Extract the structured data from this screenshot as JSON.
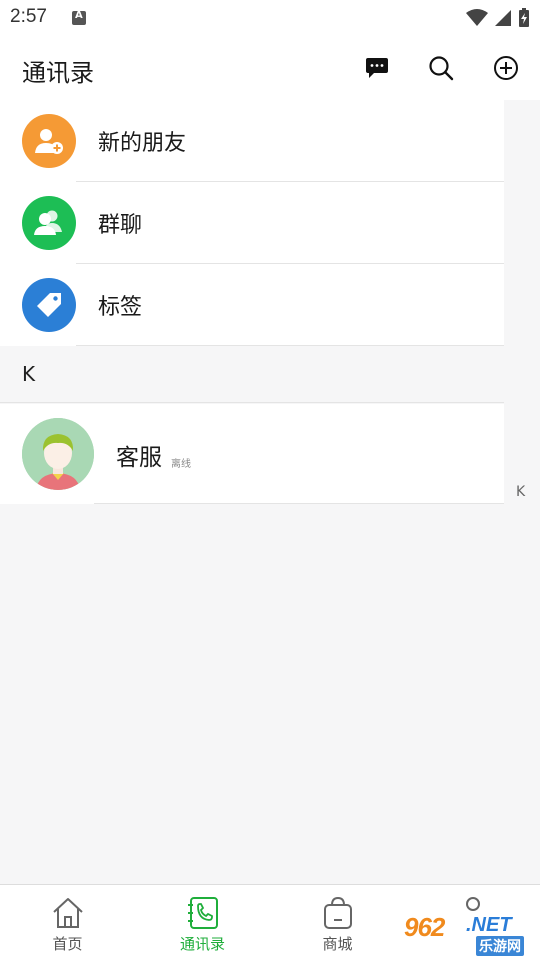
{
  "status_bar": {
    "time": "2:57"
  },
  "header": {
    "title": "通讯录"
  },
  "menu_items": [
    {
      "label": "新的朋友",
      "icon": "add-friend-icon",
      "color": "#f59a35"
    },
    {
      "label": "群聊",
      "icon": "group-chat-icon",
      "color": "#1dbe55"
    },
    {
      "label": "标签",
      "icon": "tag-icon",
      "color": "#2b7fd6"
    }
  ],
  "section": {
    "letter": "K"
  },
  "contact": {
    "name": "客服",
    "status": "离线"
  },
  "index_bar": {
    "letter": "K"
  },
  "bottom_nav": {
    "items": [
      {
        "label": "首页",
        "icon": "home-icon"
      },
      {
        "label": "通讯录",
        "icon": "contacts-icon"
      },
      {
        "label": "商城",
        "icon": "shopping-bag-icon"
      }
    ]
  },
  "watermark": {
    "number": "962",
    "suffix": ".NET",
    "text": "乐游网"
  },
  "colors": {
    "accent": "#1fae3b",
    "orange": "#f59a35",
    "green": "#1dbe55",
    "blue": "#2b7fd6"
  }
}
